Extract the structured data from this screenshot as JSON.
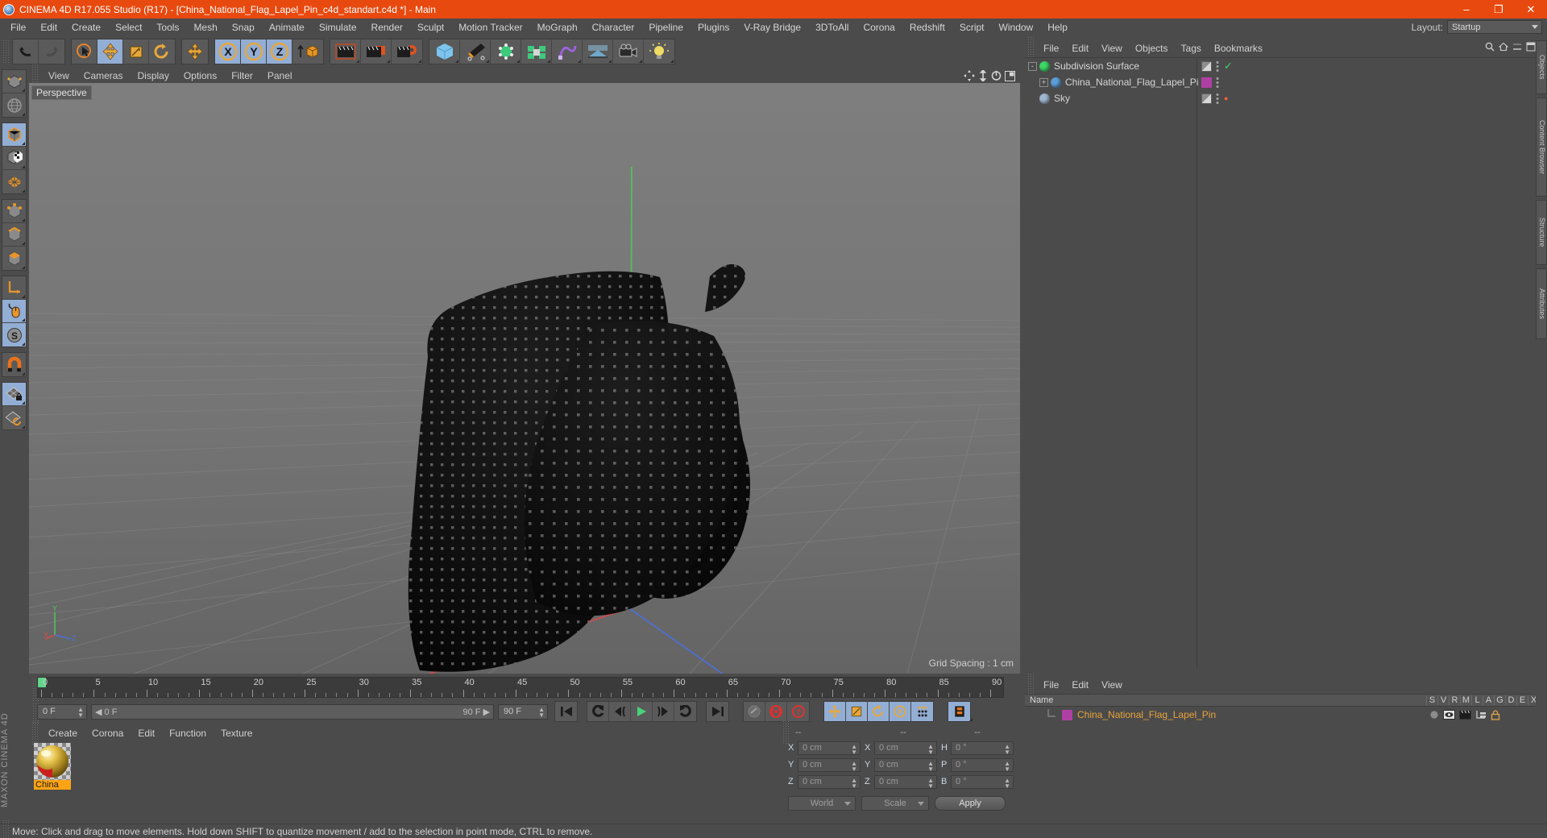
{
  "window": {
    "title": "CINEMA 4D R17.055 Studio (R17) - [China_National_Flag_Lapel_Pin_c4d_standart.c4d *] - Main",
    "app_icon": "c4d-logo-icon",
    "minimize": "–",
    "maximize": "❐",
    "close": "✕",
    "titlebar_color": "#e8490f"
  },
  "menubar": {
    "items": [
      "File",
      "Edit",
      "Create",
      "Select",
      "Tools",
      "Mesh",
      "Snap",
      "Animate",
      "Simulate",
      "Render",
      "Sculpt",
      "Motion Tracker",
      "MoGraph",
      "Character",
      "Pipeline",
      "Plugins",
      "V-Ray Bridge",
      "3DToAll",
      "Corona",
      "Redshift",
      "Script",
      "Window",
      "Help"
    ],
    "layout_label": "Layout:",
    "layout_value": "Startup"
  },
  "toolbar": {
    "groups": [
      {
        "name": "undo-redo",
        "buttons": [
          {
            "name": "undo-button",
            "icon": "undo-arrow-icon",
            "active": false
          },
          {
            "name": "redo-button",
            "icon": "redo-arrow-icon",
            "active": false
          }
        ]
      },
      {
        "name": "transform-tools",
        "buttons": [
          {
            "name": "live-selection-tool",
            "icon": "cursor-circle-icon",
            "active": false
          },
          {
            "name": "move-tool",
            "icon": "move-4arrow-icon",
            "active": true
          },
          {
            "name": "scale-tool",
            "icon": "scale-box-icon",
            "active": false
          },
          {
            "name": "rotate-tool",
            "icon": "rotate-circle-icon",
            "active": false
          }
        ]
      },
      {
        "name": "move-duplicate",
        "buttons": [
          {
            "name": "move-alt-tool",
            "icon": "move-4arrow-icon",
            "active": false
          }
        ]
      },
      {
        "name": "axis-locks",
        "buttons": [
          {
            "name": "lock-x-axis",
            "icon": "x-axis-icon",
            "label": "X",
            "active": true
          },
          {
            "name": "lock-y-axis",
            "icon": "y-axis-icon",
            "label": "Y",
            "active": true
          },
          {
            "name": "lock-z-axis",
            "icon": "z-axis-icon",
            "label": "Z",
            "active": true
          },
          {
            "name": "world-object-coordinate-toggle",
            "icon": "world-cube-icon",
            "active": false
          }
        ]
      },
      {
        "name": "render-tools",
        "buttons": [
          {
            "name": "render-view-button",
            "icon": "clapper-icon",
            "active": false
          },
          {
            "name": "render-to-picture-viewer-button",
            "icon": "clapper-picture-icon",
            "active": false
          },
          {
            "name": "render-settings-button",
            "icon": "clapper-gear-icon",
            "active": false
          }
        ]
      },
      {
        "name": "create-objects",
        "buttons": [
          {
            "name": "add-primitive-cube-button",
            "icon": "blue-cube-icon",
            "active": false
          },
          {
            "name": "add-spline-pen-button",
            "icon": "pen-nib-icon",
            "active": false
          },
          {
            "name": "add-generator-button",
            "icon": "green-cube-points-icon",
            "active": false
          },
          {
            "name": "add-mograph-array-button",
            "icon": "green-cluster-icon",
            "active": false
          },
          {
            "name": "add-deformer-button",
            "icon": "purple-deformer-icon",
            "active": false
          },
          {
            "name": "add-environment-button",
            "icon": "environment-floor-icon",
            "active": false
          },
          {
            "name": "add-camera-button",
            "icon": "camera-icon",
            "active": false
          },
          {
            "name": "add-light-button",
            "icon": "light-bulb-icon",
            "active": false
          }
        ]
      }
    ]
  },
  "left_toolbar": {
    "groups": [
      {
        "buttons": [
          {
            "name": "make-editable-button",
            "icon": "editable-mesh-icon",
            "active": false
          },
          {
            "name": "model-world-axis-button",
            "icon": "globe-axis-icon",
            "active": false
          }
        ]
      },
      {
        "buttons": [
          {
            "name": "model-mode-button",
            "icon": "model-cube-icon",
            "active": true
          },
          {
            "name": "texture-mode-button",
            "icon": "texture-checker-cube-icon",
            "active": false
          },
          {
            "name": "workplane-mode-button",
            "icon": "workplane-grid-icon",
            "active": false
          }
        ]
      },
      {
        "buttons": [
          {
            "name": "points-mode-button",
            "icon": "points-cube-icon",
            "active": false
          },
          {
            "name": "edges-mode-button",
            "icon": "edges-cube-icon",
            "active": false
          },
          {
            "name": "polygons-mode-button",
            "icon": "polygons-cube-icon",
            "active": false
          }
        ]
      },
      {
        "buttons": [
          {
            "name": "object-axis-mode-button",
            "icon": "axis-corner-icon",
            "active": false
          },
          {
            "name": "enable-axis-modification-button",
            "icon": "mouse-axis-icon",
            "active": true
          },
          {
            "name": "soft-selection-button",
            "icon": "s-circle-icon",
            "active": true
          }
        ]
      },
      {
        "buttons": [
          {
            "name": "enable-snapping-button",
            "icon": "magnet-icon",
            "active": false
          }
        ]
      },
      {
        "buttons": [
          {
            "name": "lock-workplane-button",
            "icon": "grid-lock-icon",
            "active": true
          },
          {
            "name": "planar-workplane-button",
            "icon": "grid-rotate-icon",
            "active": false
          }
        ]
      }
    ]
  },
  "viewport": {
    "menu": [
      "View",
      "Cameras",
      "Display",
      "Filter",
      "Options",
      "Panel"
    ],
    "menu_order": [
      "View",
      "Cameras",
      "Display",
      "Options",
      "Filter",
      "Panel"
    ],
    "label": "Perspective",
    "grid_spacing": "Grid Spacing : 1 cm",
    "axis_labels": {
      "y": "Y",
      "x": "X",
      "z": "Z"
    },
    "corner_icons": [
      "move-view-icon",
      "dolly-view-icon",
      "rotate-view-icon",
      "maximize-view-icon"
    ],
    "bg_top": "#7b7b7b",
    "bg_bottom": "#636363",
    "object_name": "China_National_Flag_Lapel_Pin",
    "object_color": "#0d0d0d"
  },
  "timeline": {
    "ticks": [
      {
        "label": "0",
        "value": 0
      },
      {
        "label": "5",
        "value": 5
      },
      {
        "label": "10",
        "value": 10
      },
      {
        "label": "15",
        "value": 15
      },
      {
        "label": "20",
        "value": 20
      },
      {
        "label": "25",
        "value": 25
      },
      {
        "label": "30",
        "value": 30
      },
      {
        "label": "35",
        "value": 35
      },
      {
        "label": "40",
        "value": 40
      },
      {
        "label": "45",
        "value": 45
      },
      {
        "label": "50",
        "value": 50
      },
      {
        "label": "55",
        "value": 55
      },
      {
        "label": "60",
        "value": 60
      },
      {
        "label": "65",
        "value": 65
      },
      {
        "label": "70",
        "value": 70
      },
      {
        "label": "75",
        "value": 75
      },
      {
        "label": "80",
        "value": 80
      },
      {
        "label": "85",
        "value": 85
      },
      {
        "label": "90",
        "value": 90
      }
    ],
    "current_frame": "0 F",
    "range_start": "0 F",
    "range_end": "90 F",
    "max_frame": "90 F",
    "preview_frame": "0 F",
    "playhead_color": "#62d38a",
    "buttons": [
      {
        "name": "go-to-start-button",
        "icon": "skip-start-icon",
        "active": false
      },
      {
        "name": "previous-key-button",
        "icon": "prev-key-icon",
        "active": false
      },
      {
        "name": "step-back-button",
        "icon": "step-back-icon",
        "active": false
      },
      {
        "name": "play-button",
        "icon": "play-triangle-icon",
        "active": false
      },
      {
        "name": "step-forward-button",
        "icon": "step-forward-icon",
        "active": false
      },
      {
        "name": "next-key-button",
        "icon": "next-key-icon",
        "active": false
      },
      {
        "name": "go-to-end-button",
        "icon": "skip-end-icon",
        "active": false
      },
      {
        "name": "record-active-objects-button",
        "icon": "record-dot-icon",
        "active": false
      },
      {
        "name": "autokeying-button",
        "icon": "autokey-icon",
        "active": false
      },
      {
        "name": "keyframe-selection-button",
        "icon": "question-key-icon",
        "active": false
      },
      {
        "name": "position-key-button",
        "icon": "move-4arrow-icon",
        "active": true
      },
      {
        "name": "scale-key-button",
        "icon": "scale-box-icon",
        "active": true
      },
      {
        "name": "rotation-key-button",
        "icon": "rotate-circle-icon",
        "active": true
      },
      {
        "name": "parameter-key-button",
        "icon": "p-circle-icon",
        "active": true
      },
      {
        "name": "point-level-animation-button",
        "icon": "dots-grid-icon",
        "active": true
      },
      {
        "name": "timeline-filmstrip-button",
        "icon": "filmstrip-icon",
        "active": true
      }
    ]
  },
  "material_manager": {
    "menu": [
      "Create",
      "Corona",
      "Edit",
      "Function",
      "Texture"
    ],
    "materials": [
      {
        "name": "China",
        "selected": true,
        "swatch": "gold-red-sphere"
      }
    ]
  },
  "coordinates": {
    "header": [
      "--",
      "--",
      "--"
    ],
    "rows": [
      {
        "l1": "X",
        "v1": "0 cm",
        "l2": "X",
        "v2": "0 cm",
        "l3": "H",
        "v3": "0 °"
      },
      {
        "l1": "Y",
        "v1": "0 cm",
        "l2": "Y",
        "v2": "0 cm",
        "l3": "P",
        "v3": "0 °"
      },
      {
        "l1": "Z",
        "v1": "0 cm",
        "l2": "Z",
        "v2": "0 cm",
        "l3": "B",
        "v3": "0 °"
      }
    ],
    "coord_system": "World",
    "size_mode": "Scale",
    "apply_label": "Apply"
  },
  "object_manager": {
    "menu": [
      "File",
      "Edit",
      "View",
      "Objects",
      "Tags",
      "Bookmarks"
    ],
    "header_icons": [
      "search-icon",
      "home-icon",
      "minimize-panel-icon",
      "maximize-panel-icon"
    ],
    "items": [
      {
        "name": "Subdivision Surface",
        "icon": "subdivision-surface-icon",
        "icon_color": "#3ed666",
        "indent": 0,
        "expander": "-",
        "selected": false,
        "tags": [
          {
            "type": "display-tag",
            "color": "#8d8d8d"
          }
        ],
        "dots": true,
        "check": "✓",
        "check_color": "#3ed666"
      },
      {
        "name": "China_National_Flag_Lapel_Pin",
        "icon": "polygon-object-icon",
        "icon_color": "#5c9fd6",
        "indent": 1,
        "expander": "+",
        "selected": false,
        "tags": [
          {
            "type": "material-tag",
            "color": "#b03fa4"
          }
        ],
        "dots": true,
        "check": "",
        "check_color": ""
      },
      {
        "name": "Sky",
        "icon": "sky-object-icon",
        "icon_color": "#9fb6cf",
        "indent": 0,
        "expander": "",
        "selected": false,
        "tags": [
          {
            "type": "display-tag",
            "color": "#8d8d8d"
          }
        ],
        "dots": true,
        "check": "●",
        "check_color": "#ff5a3c"
      }
    ]
  },
  "attribute_manager": {
    "menu": [
      "File",
      "Edit",
      "View"
    ],
    "columns": [
      "Name",
      "S",
      "V",
      "R",
      "M",
      "L",
      "A",
      "G",
      "D",
      "E",
      "X"
    ],
    "rows": [
      {
        "name": "China_National_Flag_Lapel_Pin",
        "swatch": "#b03fa4",
        "name_color": "#e8a33d",
        "icons": [
          "s-dot-icon",
          "visible-eye-icon",
          "render-clapper-icon",
          "layer-icon",
          "lock-icon"
        ]
      }
    ]
  },
  "right_dock": {
    "tabs": [
      "Objects",
      "Content Browser",
      "Structure",
      "Attributes"
    ]
  },
  "left_dock": {
    "brand": "MAXON CINEMA 4D"
  },
  "statusbar": {
    "message": "Move: Click and drag to move elements. Hold down SHIFT to quantize movement / add to the selection in point mode, CTRL to remove."
  }
}
